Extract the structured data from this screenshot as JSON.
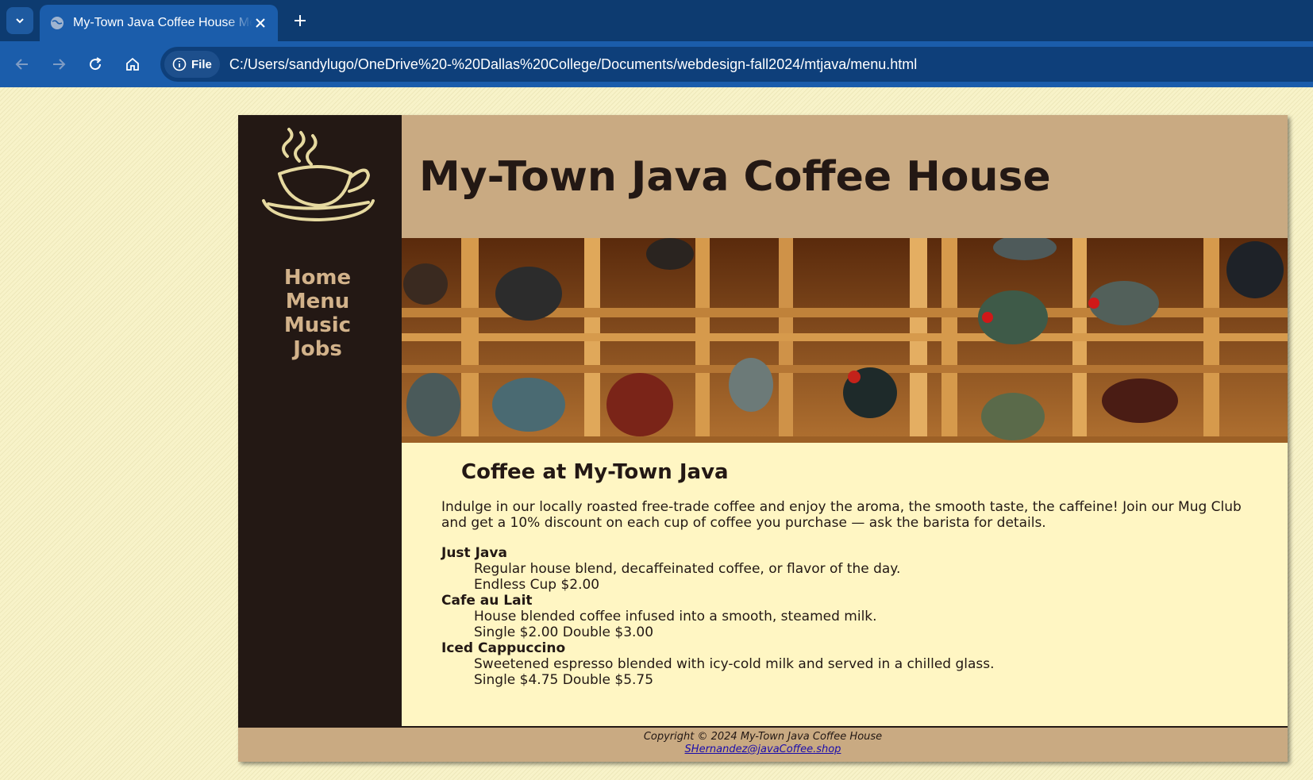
{
  "browser": {
    "tab_title": "My-Town Java Coffee House Menu",
    "site_chip_label": "File",
    "url": "C:/Users/sandylugo/OneDrive%20-%20Dallas%20College/Documents/webdesign-fall2024/mtjava/menu.html",
    "icons": [
      "chevron-down-icon",
      "globe-icon",
      "close-icon",
      "plus-icon",
      "back-icon",
      "forward-icon",
      "reload-icon",
      "home-icon",
      "info-icon"
    ]
  },
  "page": {
    "title": "My-Town Java Coffee House",
    "nav": [
      "Home",
      "Menu",
      "Music",
      "Jobs"
    ],
    "heading": "Coffee at My-Town Java",
    "intro": "Indulge in our locally roasted free-trade coffee and enjoy the aroma, the smooth taste, the caffeine! Join our Mug Club and get a 10% discount on each cup of coffee you purchase — ask the barista for details.",
    "menu_items": [
      {
        "name": "Just Java",
        "description": "Regular house blend, decaffeinated coffee, or flavor of the day.",
        "price": "Endless Cup $2.00"
      },
      {
        "name": "Cafe au Lait",
        "description": "House blended coffee infused into a smooth, steamed milk.",
        "price": "Single $2.00 Double $3.00"
      },
      {
        "name": "Iced Cappuccino",
        "description": "Sweetened espresso blended with icy-cold milk and served in a chilled glass.",
        "price": "Single $4.75 Double $5.75"
      }
    ],
    "footer": {
      "copyright": "Copyright © 2024 My-Town Java Coffee House",
      "email": "SHernandez@javaCoffee.shop"
    }
  },
  "colors": {
    "sidebar": "#231814",
    "header": "#c9aa82",
    "nav_text": "#d2b28a",
    "content_bg": "#fff6c3",
    "browser_tabbar": "#0d3b70",
    "browser_toolbar": "#1b5dab"
  }
}
